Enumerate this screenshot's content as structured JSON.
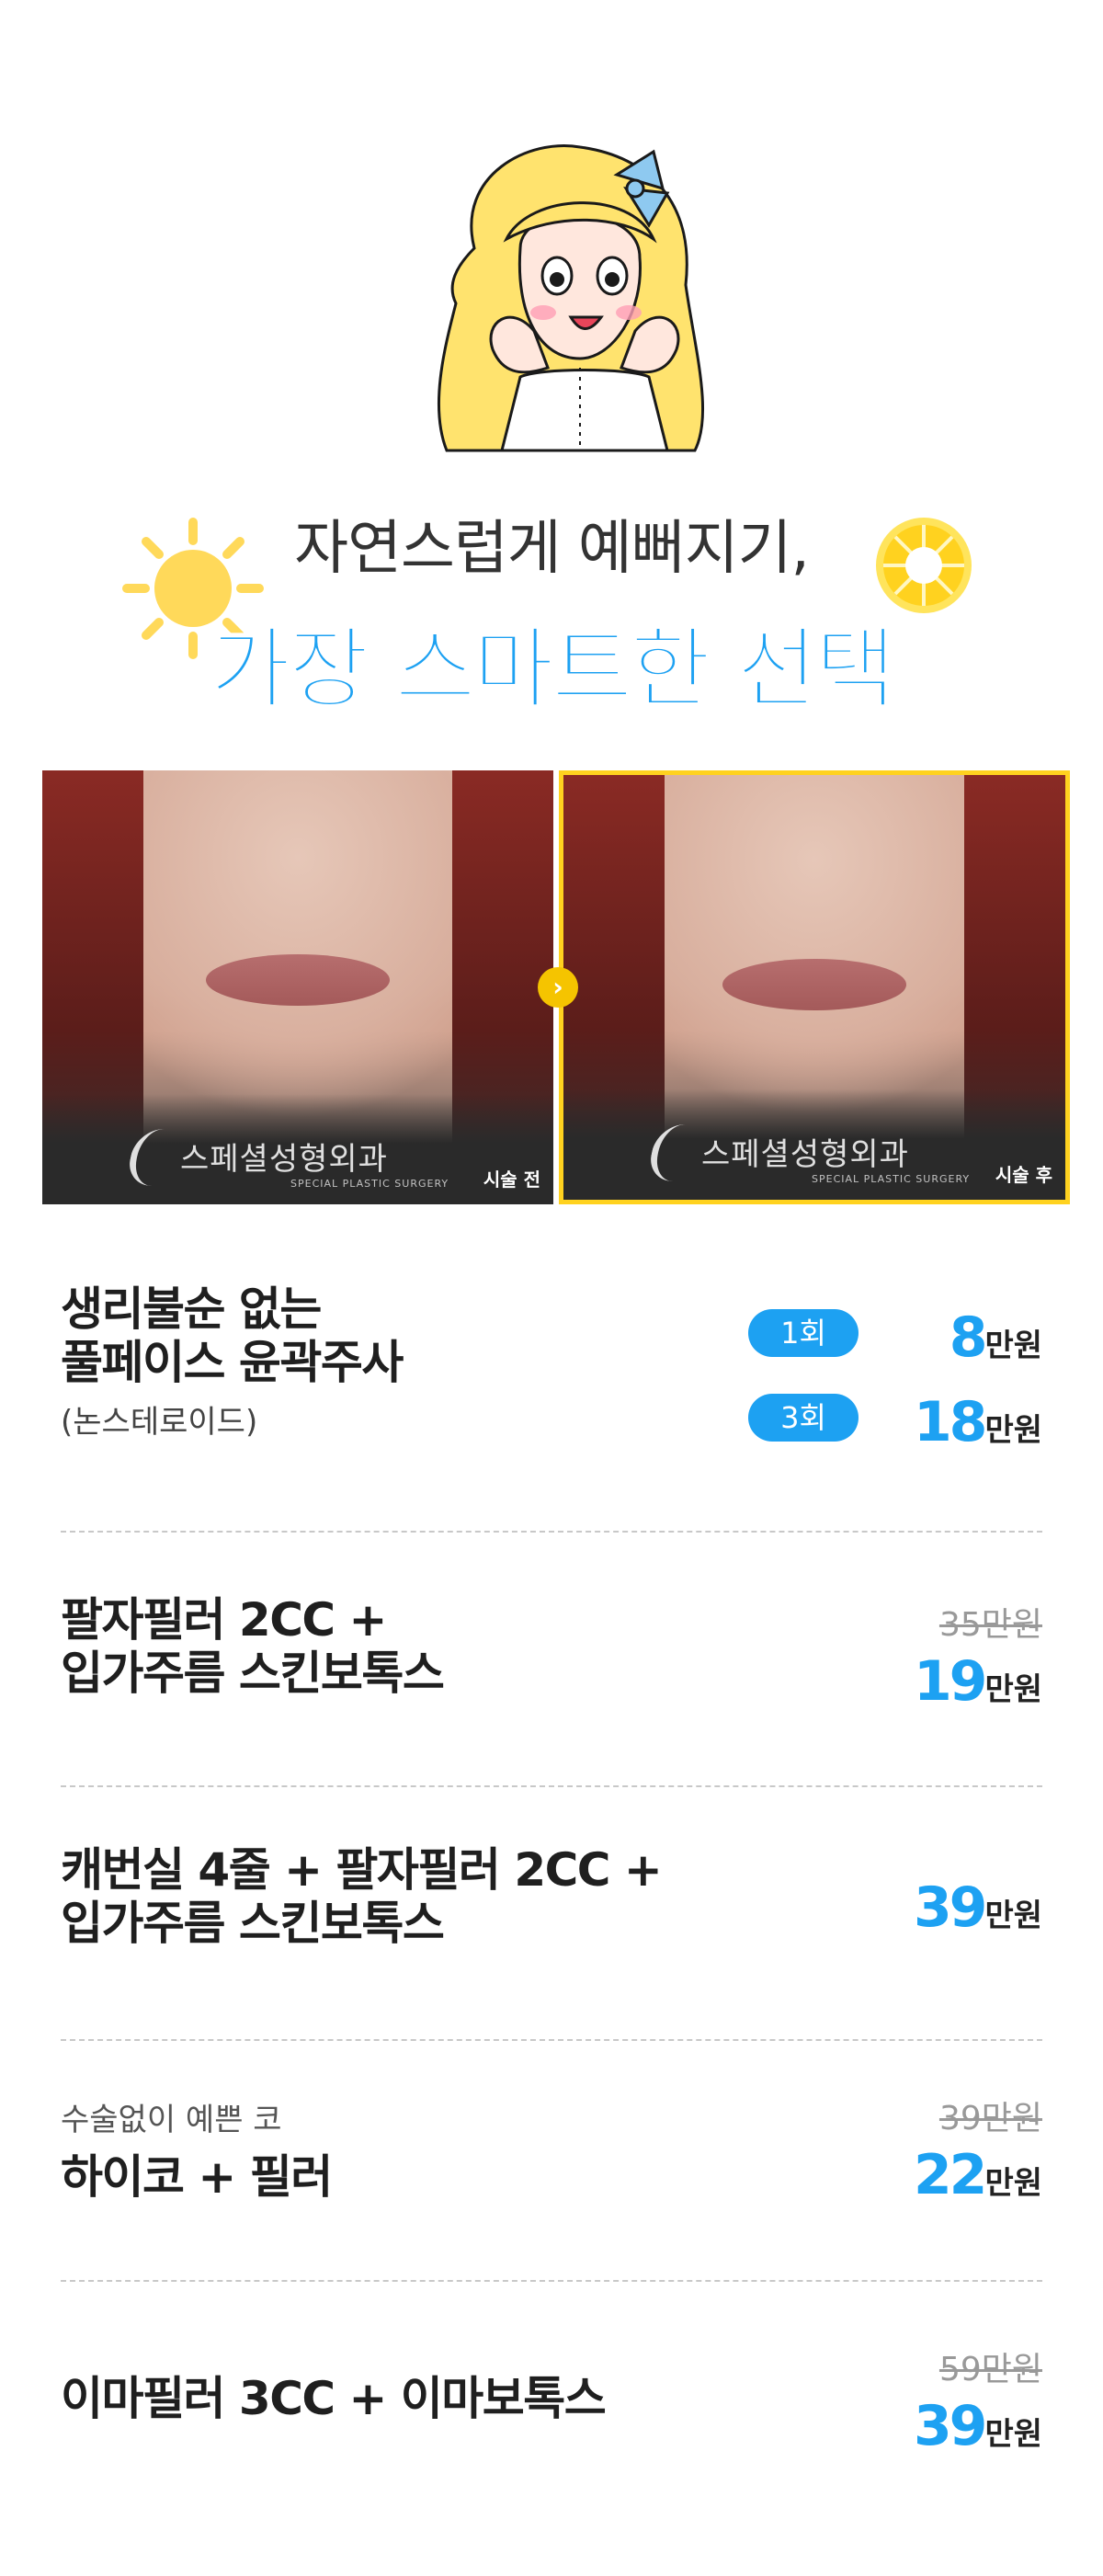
{
  "hero": {
    "headline_line1": "자연스럽게 예뻐지기,",
    "headline_line2": "가장 스마트한 선택"
  },
  "photos": {
    "before": {
      "watermark": "스페셜성형외과",
      "watermark_sub": "SPECIAL PLASTIC SURGERY",
      "caption": "시술 전"
    },
    "after": {
      "watermark": "스페셜성형외과",
      "watermark_sub": "SPECIAL PLASTIC SURGERY",
      "caption": "시술 후"
    },
    "arrow": "›"
  },
  "items": [
    {
      "title_line1": "생리불순 없는",
      "title_line2": "풀페이스 윤곽주사",
      "sub": "(논스테로이드)",
      "options": [
        {
          "badge": "1회",
          "price": "8",
          "unit": "만원"
        },
        {
          "badge": "3회",
          "price": "18",
          "unit": "만원"
        }
      ]
    },
    {
      "title_line1": "팔자필러 2CC +",
      "title_line2": "입가주름 스킨보톡스",
      "old_price": "35만원",
      "price": "19",
      "unit": "만원"
    },
    {
      "title_line1": "캐번실 4줄 + 팔자필러 2CC +",
      "title_line2": "입가주름 스킨보톡스",
      "price": "39",
      "unit": "만원"
    },
    {
      "pre": "수술없이 예쁜 코",
      "title_line1": "하이코 + 필러",
      "old_price": "39만원",
      "price": "22",
      "unit": "만원"
    },
    {
      "title_line1": "이마필러 3CC + 이마보톡스",
      "old_price": "59만원",
      "price": "39",
      "unit": "만원"
    }
  ],
  "colors": {
    "accent": "#1da1f2",
    "highlight_border": "#ffd21f"
  }
}
